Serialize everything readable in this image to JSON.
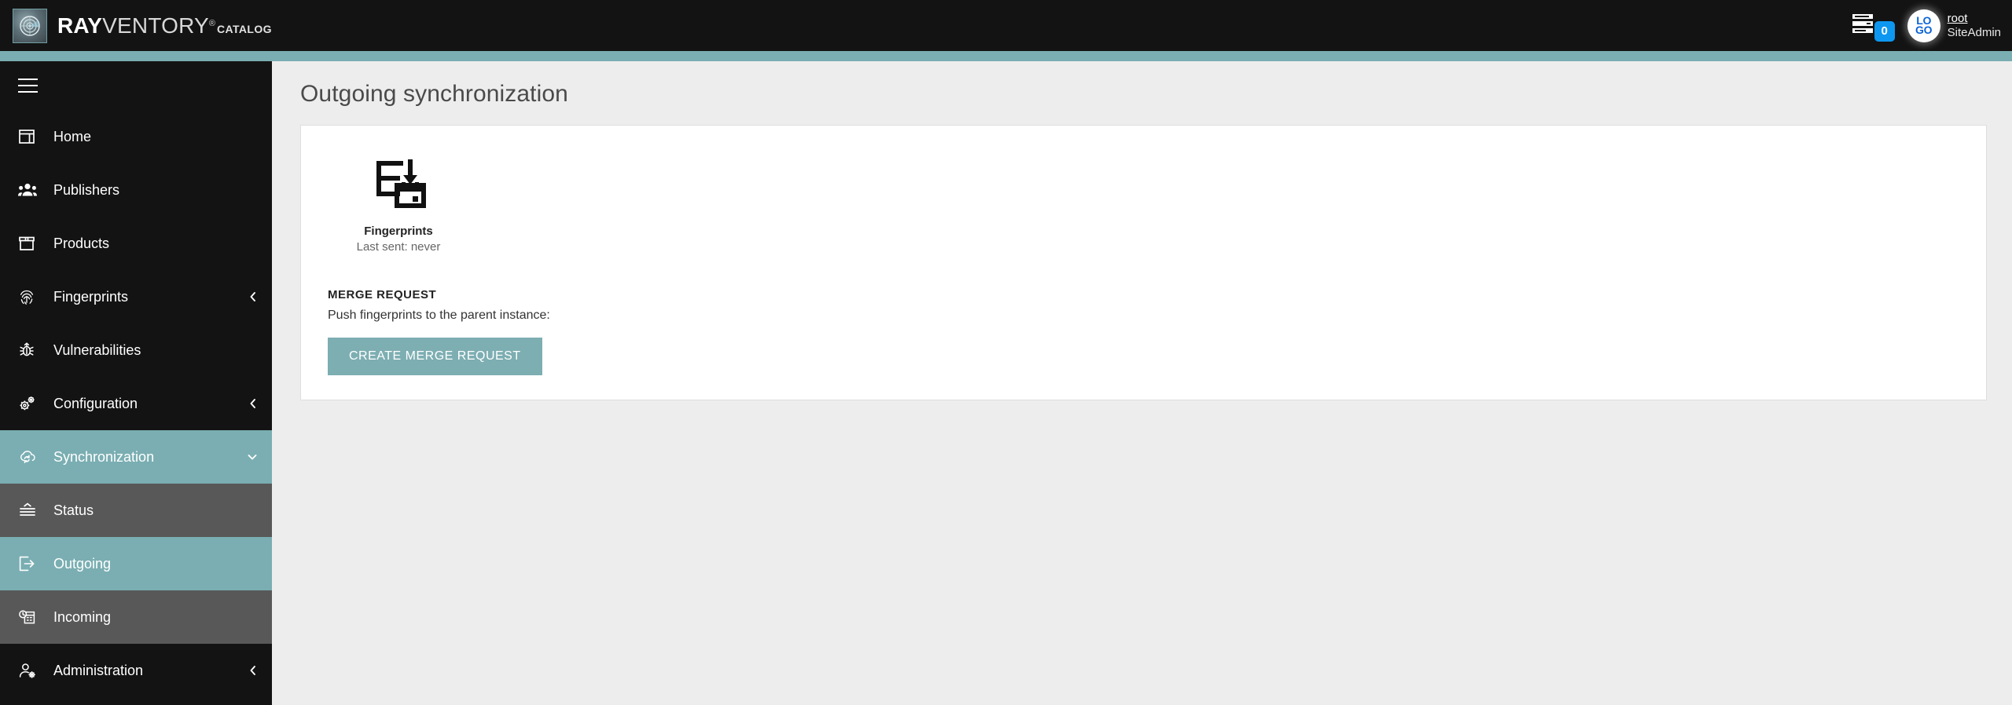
{
  "header": {
    "brand": {
      "logo_icon": "radar-target-icon",
      "name_bold": "RAY",
      "name_light": "VENTORY",
      "registered_mark": "®",
      "suffix": "CATALOG"
    },
    "tasks": {
      "icon": "task-queue-icon",
      "badge_count": "0",
      "badge_color": "#0e97f0"
    },
    "user": {
      "avatar_line1": "LO",
      "avatar_line2": "GO",
      "login": "root",
      "role": "SiteAdmin"
    }
  },
  "accent_color": "#7aaeb2",
  "sidebar": {
    "menu_toggle": {
      "icon": "hamburger-menu-icon",
      "label": "Menu"
    },
    "items": [
      {
        "label": "Home",
        "icon": "dashboard-icon",
        "state": "default",
        "chevron": "none"
      },
      {
        "label": "Publishers",
        "icon": "people-group-icon",
        "state": "default",
        "chevron": "none"
      },
      {
        "label": "Products",
        "icon": "package-box-icon",
        "state": "default",
        "chevron": "none"
      },
      {
        "label": "Fingerprints",
        "icon": "fingerprint-icon",
        "state": "default",
        "chevron": "left"
      },
      {
        "label": "Vulnerabilities",
        "icon": "bug-icon",
        "state": "default",
        "chevron": "none"
      },
      {
        "label": "Configuration",
        "icon": "gears-icon",
        "state": "default",
        "chevron": "left"
      },
      {
        "label": "Synchronization",
        "icon": "cloud-sync-icon",
        "state": "expanded-active",
        "chevron": "down"
      },
      {
        "label": "Status",
        "icon": "status-lines-icon",
        "state": "sub-hover",
        "chevron": "none"
      },
      {
        "label": "Outgoing",
        "icon": "export-arrow-icon",
        "state": "sub-active",
        "chevron": "none"
      },
      {
        "label": "Incoming",
        "icon": "import-calendar-icon",
        "state": "sub-hover",
        "chevron": "none"
      },
      {
        "label": "Administration",
        "icon": "user-gear-icon",
        "state": "default",
        "chevron": "left"
      }
    ]
  },
  "main": {
    "page_title": "Outgoing synchronization",
    "sync_target": {
      "icon": "fingerprint-export-icon",
      "name": "Fingerprints",
      "last_sent_label": "Last sent: never"
    },
    "merge_request": {
      "section_title": "MERGE REQUEST",
      "description": "Push fingerprints to the parent instance:",
      "button_label": "CREATE MERGE REQUEST",
      "button_color": "#7daeb2"
    }
  }
}
